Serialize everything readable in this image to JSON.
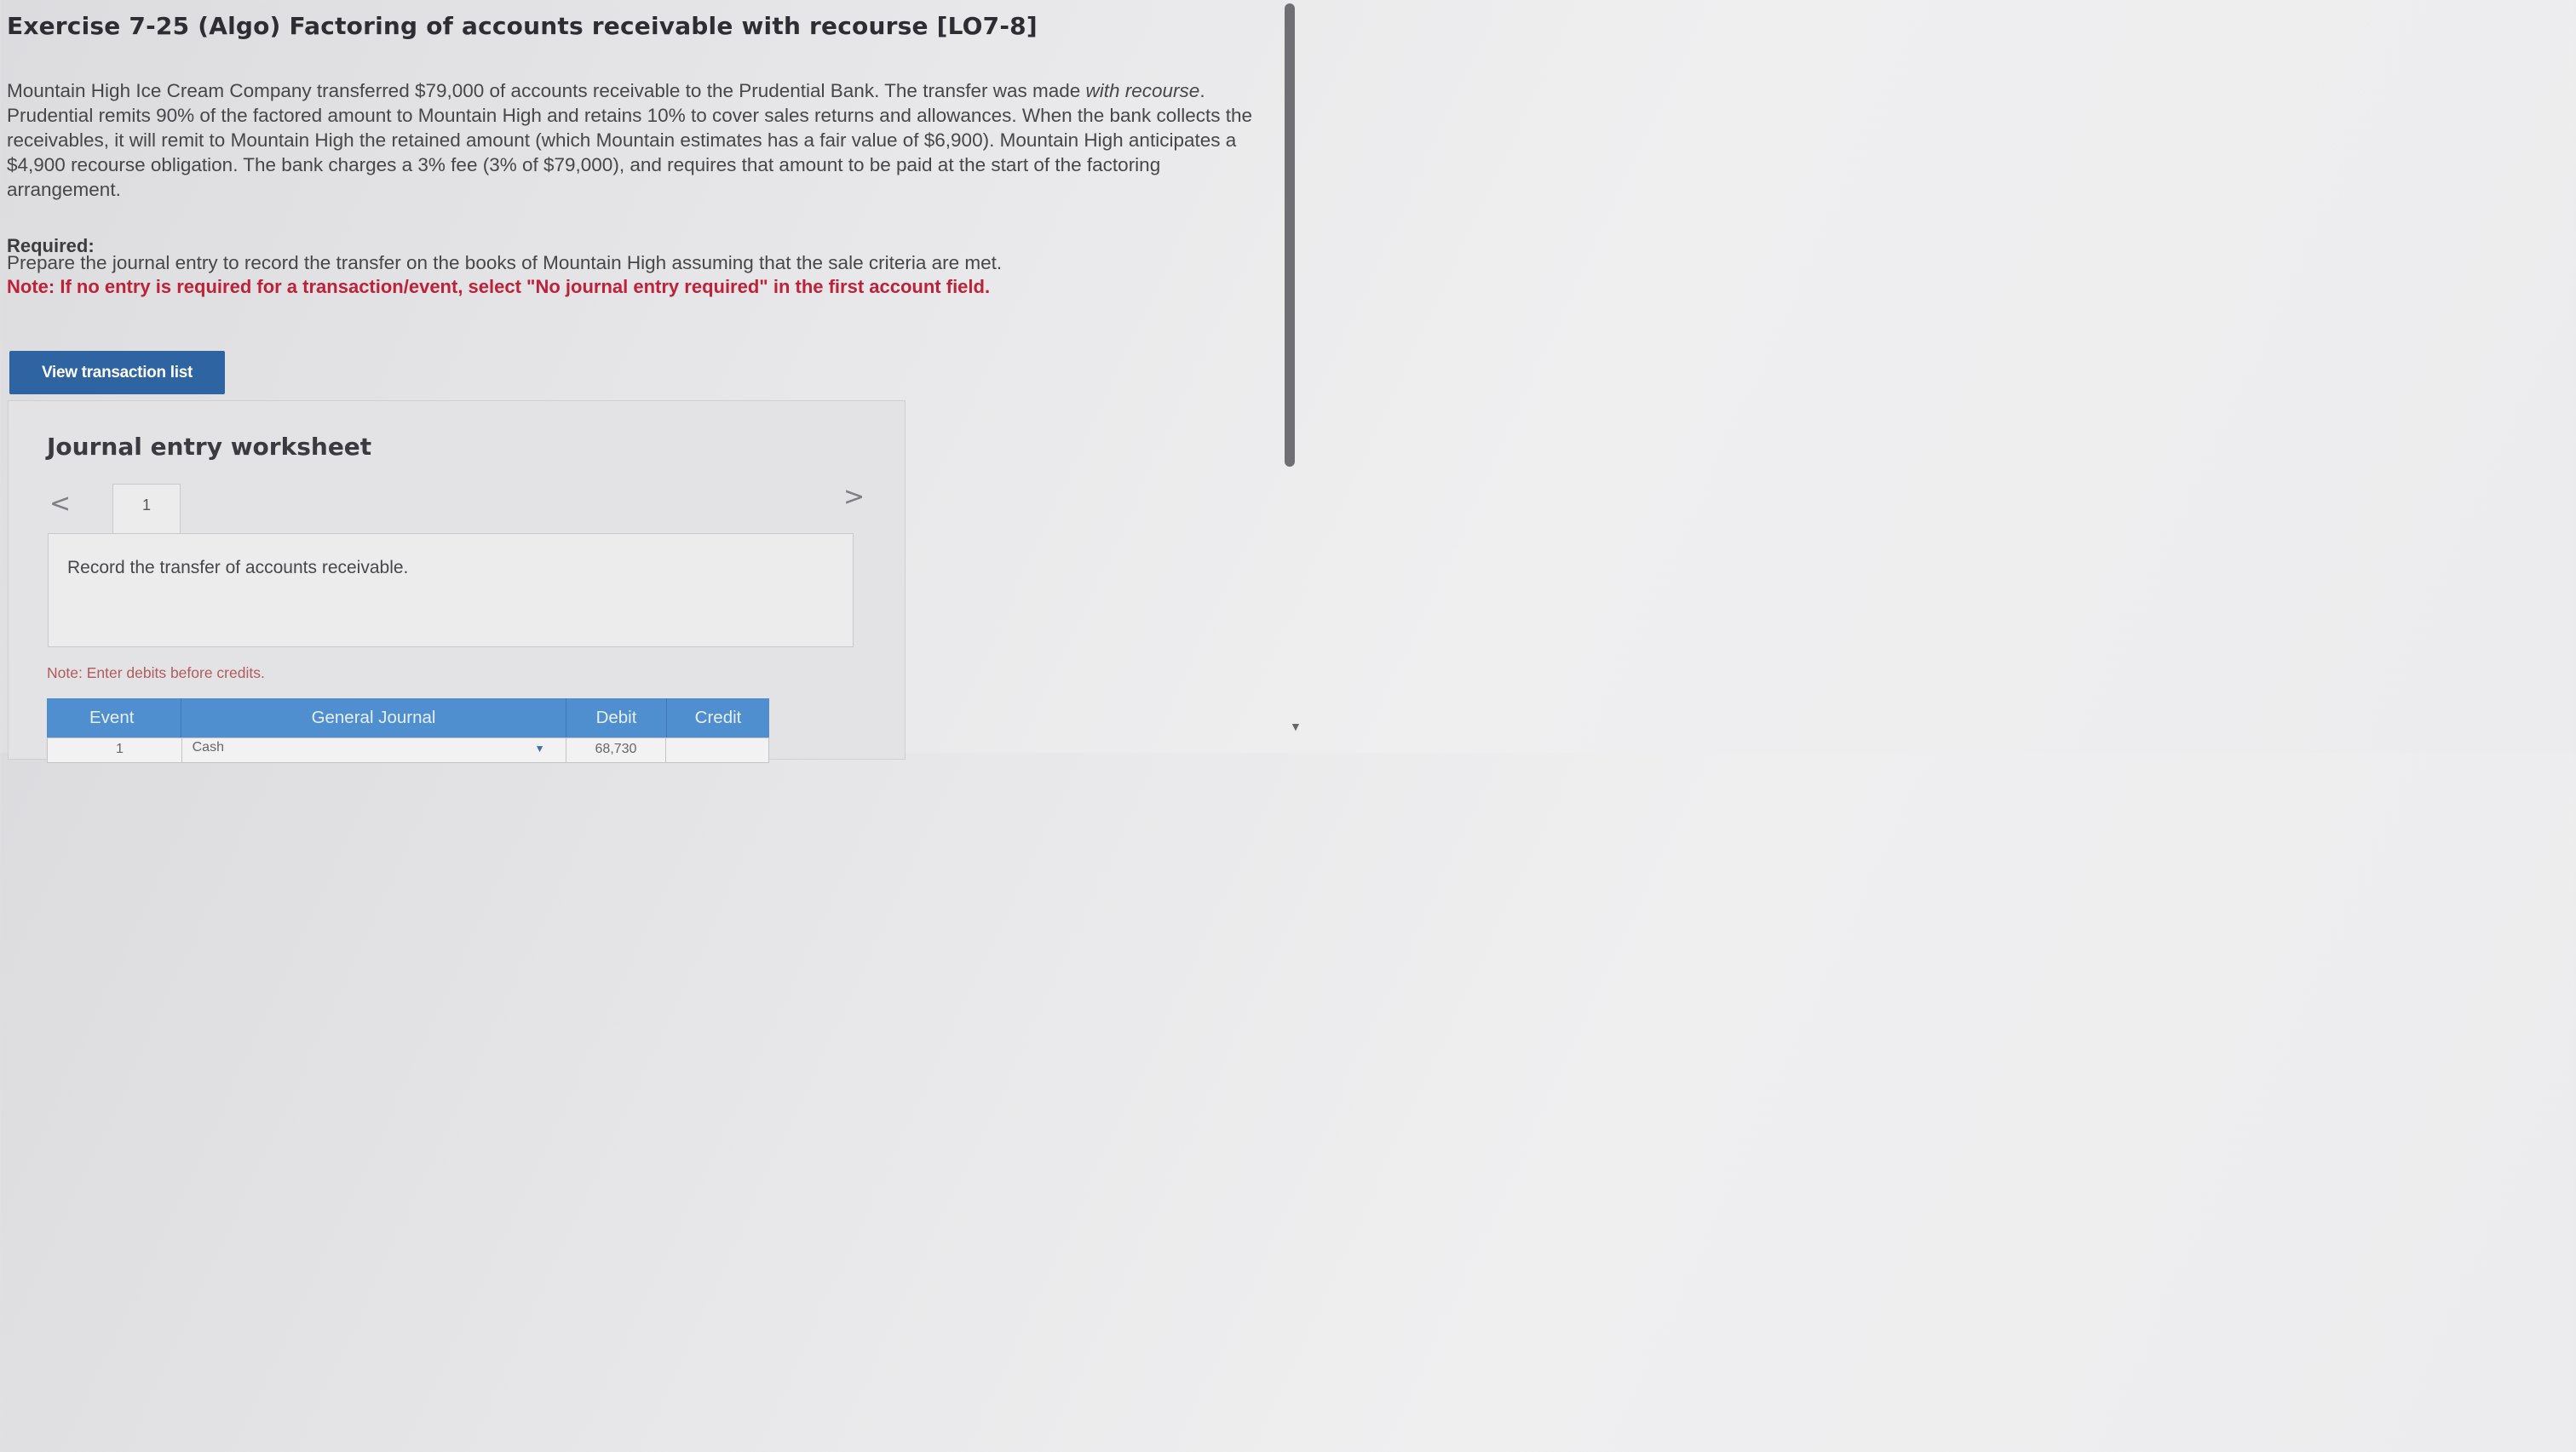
{
  "title": "Exercise 7-25 (Algo) Factoring of accounts receivable with recourse [LO7-8]",
  "paragraph": {
    "part1": "Mountain High Ice Cream Company transferred $79,000 of accounts receivable to the Prudential Bank. The transfer was made ",
    "italic": "with recourse",
    "part2": ". Prudential remits 90% of the factored amount to Mountain High and retains 10% to cover sales returns and allowances. When the bank collects the receivables, it will remit to Mountain High the retained amount (which Mountain estimates has a fair value of $6,900). Mountain High anticipates a $4,900 recourse obligation. The bank charges a 3% fee (3% of $79,000), and requires that amount to be paid at the start of the factoring arrangement."
  },
  "required": {
    "label": "Required:",
    "text": "Prepare the journal entry to record the transfer on the books of Mountain High assuming that the sale criteria are met.",
    "note": "Note: If no entry is required for a transaction/event, select \"No journal entry required\" in the first account field."
  },
  "view_button": "View transaction list",
  "worksheet": {
    "title": "Journal entry worksheet",
    "prev": "<",
    "next": ">",
    "tab": "1",
    "description": "Record the transfer of accounts receivable.",
    "note": "Note: Enter debits before credits.",
    "headers": [
      "Event",
      "General Journal",
      "Debit",
      "Credit"
    ],
    "row": {
      "event": "1",
      "account": "Cash",
      "debit": "68,730",
      "credit": ""
    }
  },
  "icons": {
    "dropdown": "chevron-down-icon",
    "scroll_down": "scroll-down-icon"
  }
}
